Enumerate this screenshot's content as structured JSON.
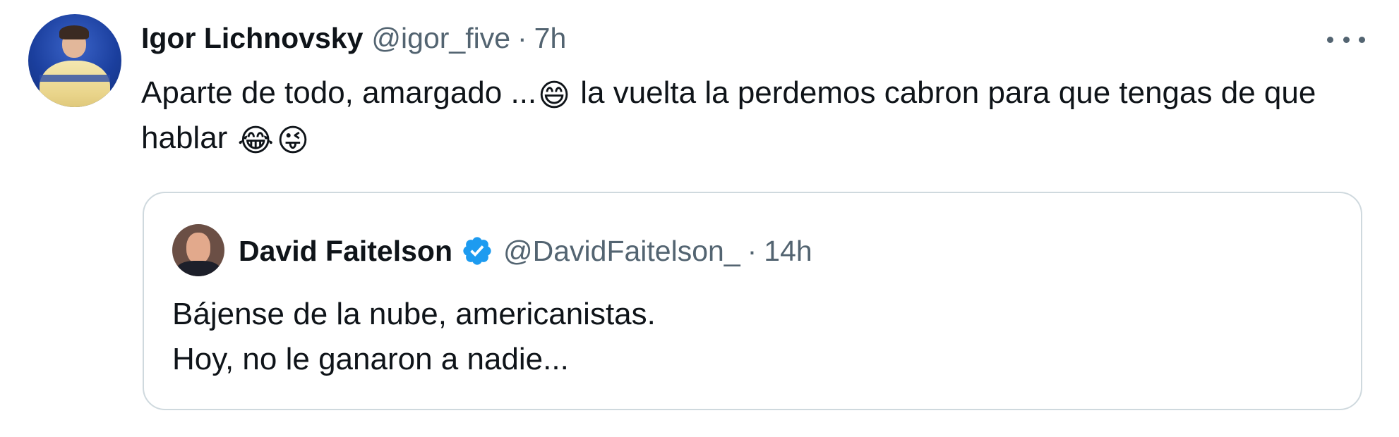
{
  "tweet": {
    "author_name": "Igor Lichnovsky",
    "author_handle": "@igor_five",
    "separator": "·",
    "time": "7h",
    "text_part1": "Aparte de todo, amargado ...",
    "emoji1": "😄",
    "text_part2": " la vuelta la perdemos cabron para que tengas de que hablar ",
    "emoji2": "😂",
    "emoji3": "😜",
    "more_icon": "more-horizontal-icon"
  },
  "quote": {
    "author_name": "David Faitelson",
    "author_handle": "@DavidFaitelson_",
    "separator": "·",
    "time": "14h",
    "verified_color": "#1d9bf0",
    "line1": "Bájense de la nube, americanistas.",
    "line2": "Hoy, no le ganaron a nadie..."
  },
  "colors": {
    "text": "#0f1419",
    "secondary": "#536471",
    "border": "#cfd9de"
  }
}
